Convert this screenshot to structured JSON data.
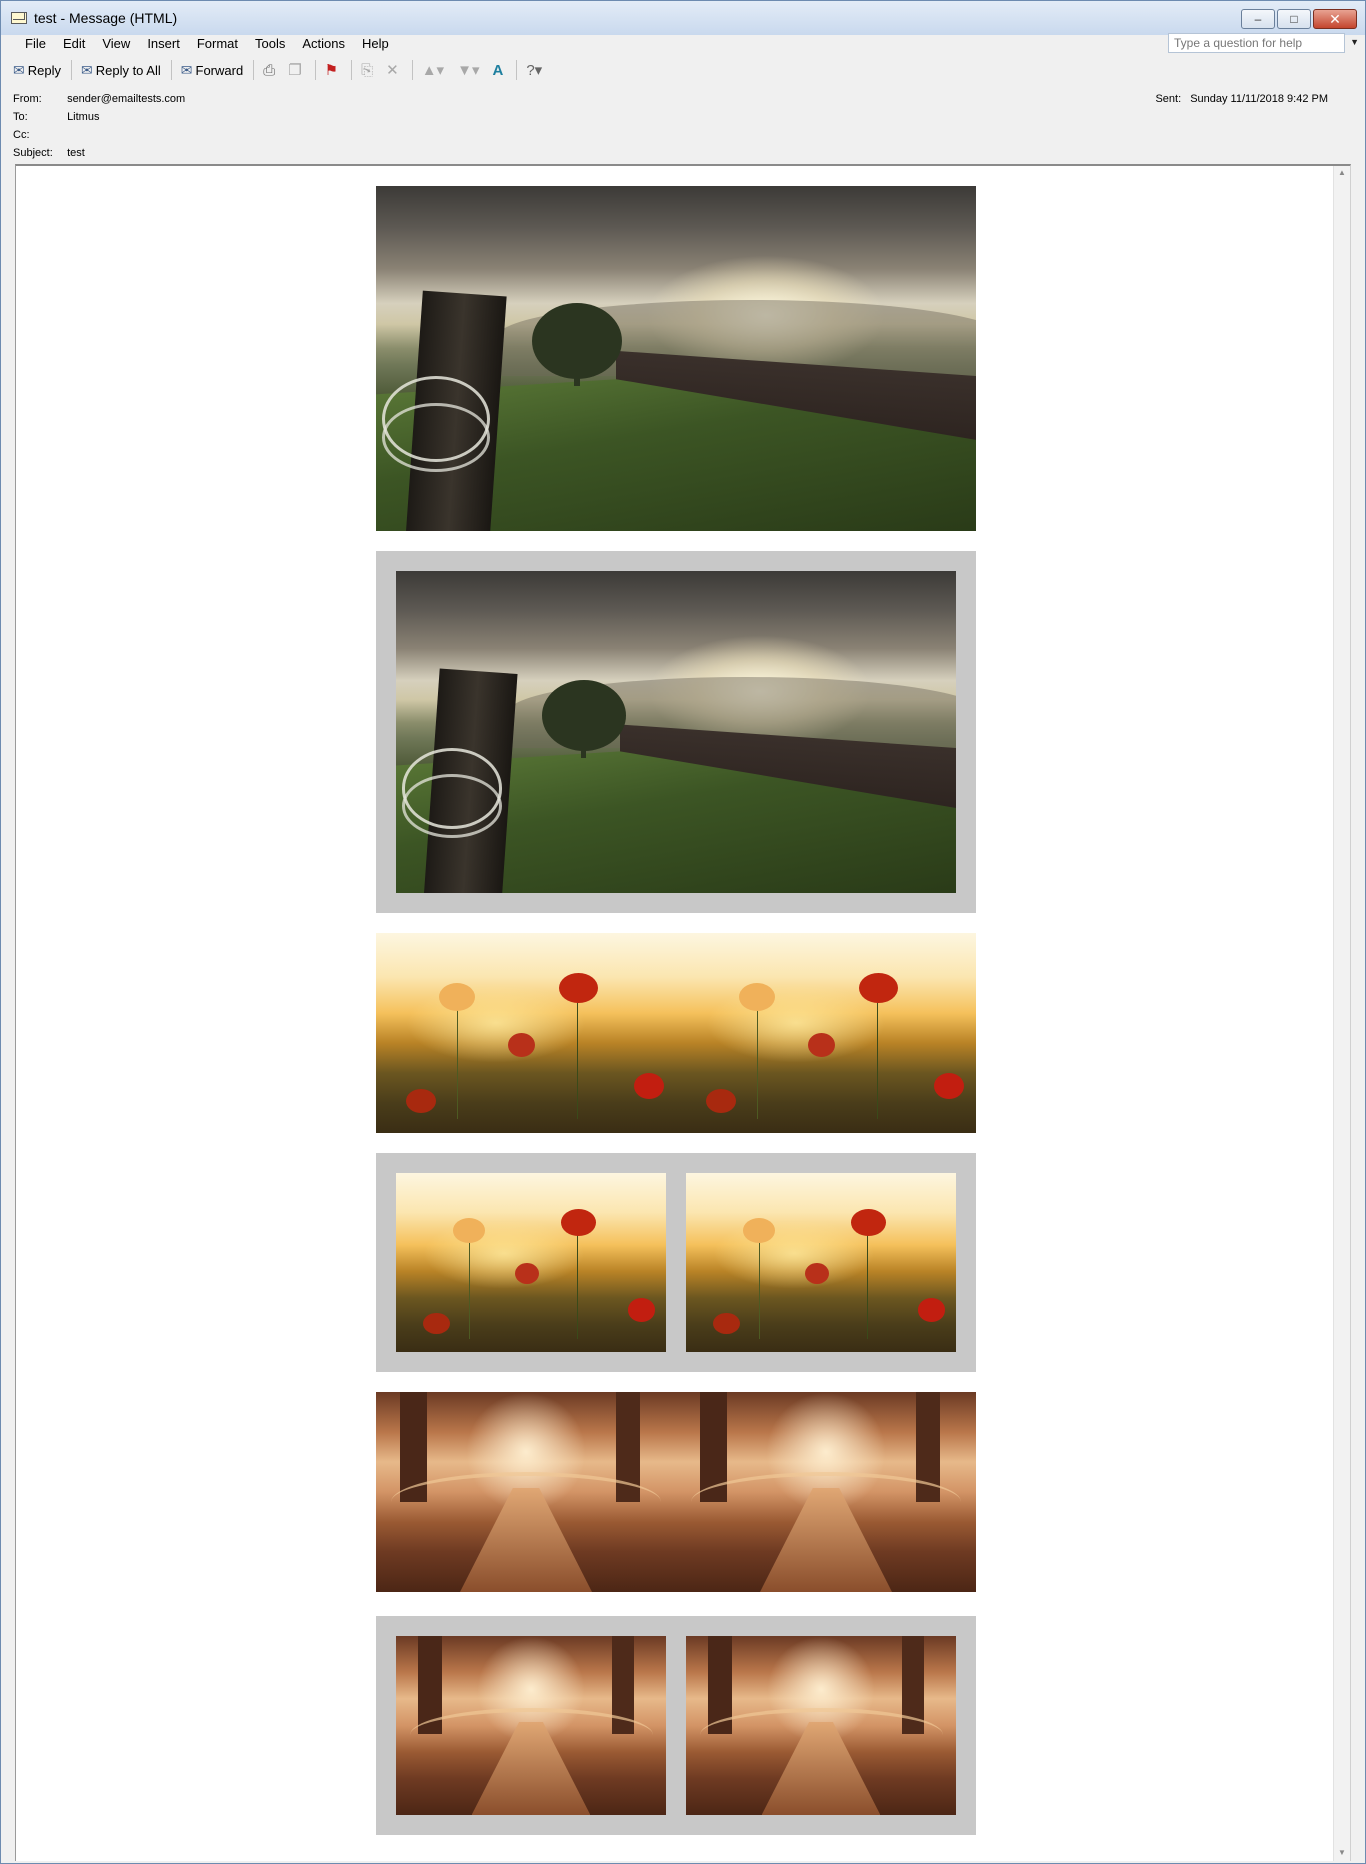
{
  "window": {
    "title": "test - Message (HTML)",
    "buttons": {
      "minimize": "–",
      "maximize": "□",
      "close": "✕"
    }
  },
  "menu": {
    "items": [
      "File",
      "Edit",
      "View",
      "Insert",
      "Format",
      "Tools",
      "Actions",
      "Help"
    ],
    "help_placeholder": "Type a question for help"
  },
  "toolbar": {
    "reply": "Reply",
    "reply_all": "Reply to All",
    "forward": "Forward"
  },
  "header": {
    "from_label": "From:",
    "from_value": "sender@emailtests.com",
    "to_label": "To:",
    "to_value": "Litmus",
    "cc_label": "Cc:",
    "cc_value": "",
    "subject_label": "Subject:",
    "subject_value": "test",
    "sent_label": "Sent:",
    "sent_value": "Sunday 11/11/2018 9:42 PM"
  },
  "body": {
    "images": [
      {
        "kind": "landscape",
        "framed": false,
        "count": 1
      },
      {
        "kind": "landscape",
        "framed": true,
        "count": 1
      },
      {
        "kind": "poppy",
        "framed": false,
        "count": 2
      },
      {
        "kind": "poppy",
        "framed": true,
        "count": 2
      },
      {
        "kind": "bridge",
        "framed": false,
        "count": 2
      },
      {
        "kind": "bridge",
        "framed": true,
        "count": 2
      }
    ],
    "frame_color": "#c8c8c8"
  }
}
